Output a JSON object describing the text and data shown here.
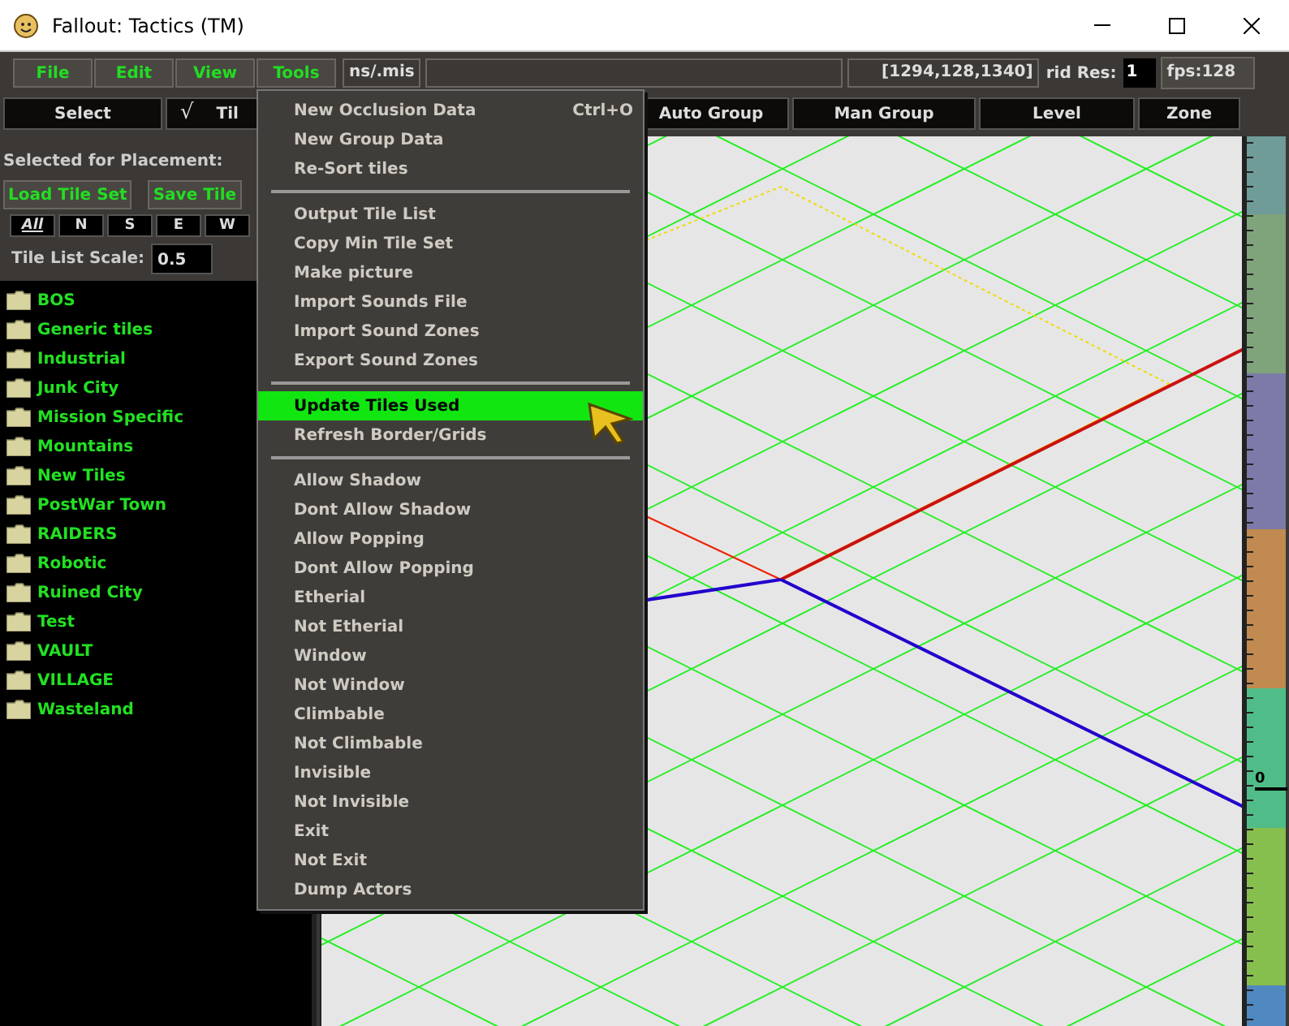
{
  "window": {
    "title": "Fallout: Tactics (TM)"
  },
  "menubar": [
    {
      "label": "File"
    },
    {
      "label": "Edit"
    },
    {
      "label": "View"
    },
    {
      "label": "Tools"
    }
  ],
  "status": {
    "file": "ns/.mis",
    "coords": "[1294,128,1340]",
    "res_label": "rid Res:",
    "res_value": "1",
    "fps": "fps:128"
  },
  "check_glyph": "√",
  "toolbar": [
    {
      "label": "Select",
      "checked": false
    },
    {
      "label": "Til",
      "checked": true
    },
    {
      "label": "Auto Group",
      "checked": false
    },
    {
      "label": "Man Group",
      "checked": false
    },
    {
      "label": "Level",
      "checked": false
    },
    {
      "label": "Zone",
      "checked": false
    }
  ],
  "left_panel": {
    "heading": "Selected for Placement:",
    "buttons": [
      "Load Tile Set",
      "Save Tile"
    ],
    "directions": [
      {
        "label": "All",
        "checked": true
      },
      {
        "label": "N",
        "checked": false
      },
      {
        "label": "S",
        "checked": false
      },
      {
        "label": "E",
        "checked": false
      },
      {
        "label": "W",
        "checked": false
      }
    ],
    "scale_label": "Tile List Scale:",
    "scale_value": "0.5",
    "folders": [
      "BOS",
      "Generic tiles",
      "Industrial",
      "Junk City",
      "Mission Specific",
      "Mountains",
      "New Tiles",
      "PostWar Town",
      "RAIDERS",
      "Robotic",
      "Ruined City",
      "Test",
      "VAULT",
      "VILLAGE",
      "Wasteland"
    ]
  },
  "tools_menu": [
    {
      "kind": "item",
      "label": "New Occlusion Data",
      "shortcut": "Ctrl+O",
      "selected": false
    },
    {
      "kind": "item",
      "label": "New Group Data",
      "selected": false
    },
    {
      "kind": "item",
      "label": "Re-Sort tiles",
      "selected": false
    },
    {
      "kind": "separator"
    },
    {
      "kind": "item",
      "label": "Output Tile List",
      "selected": false
    },
    {
      "kind": "item",
      "label": "Copy Min Tile Set",
      "selected": false
    },
    {
      "kind": "item",
      "label": "Make picture",
      "selected": false
    },
    {
      "kind": "item",
      "label": "Import Sounds File",
      "selected": false
    },
    {
      "kind": "item",
      "label": "Import Sound Zones",
      "selected": false
    },
    {
      "kind": "item",
      "label": "Export Sound Zones",
      "selected": false
    },
    {
      "kind": "separator"
    },
    {
      "kind": "item",
      "label": "Update Tiles Used",
      "selected": true
    },
    {
      "kind": "item",
      "label": "Refresh Border/Grids",
      "selected": false
    },
    {
      "kind": "separator"
    },
    {
      "kind": "item",
      "label": "Allow Shadow",
      "selected": false
    },
    {
      "kind": "item",
      "label": "Dont Allow Shadow",
      "selected": false
    },
    {
      "kind": "item",
      "label": "Allow Popping",
      "selected": false
    },
    {
      "kind": "item",
      "label": "Dont Allow Popping",
      "selected": false
    },
    {
      "kind": "item",
      "label": "Etherial",
      "selected": false
    },
    {
      "kind": "item",
      "label": "Not Etherial",
      "selected": false
    },
    {
      "kind": "item",
      "label": "Window",
      "selected": false
    },
    {
      "kind": "item",
      "label": "Not Window",
      "selected": false
    },
    {
      "kind": "item",
      "label": "Climbable",
      "selected": false
    },
    {
      "kind": "item",
      "label": "Not Climbable",
      "selected": false
    },
    {
      "kind": "item",
      "label": "Invisible",
      "selected": false
    },
    {
      "kind": "item",
      "label": "Not Invisible",
      "selected": false
    },
    {
      "kind": "item",
      "label": "Exit",
      "selected": false
    },
    {
      "kind": "item",
      "label": "Not Exit",
      "selected": false
    },
    {
      "kind": "item",
      "label": "Dump Actors",
      "selected": false
    }
  ],
  "level_ruler": {
    "marker": "0"
  }
}
